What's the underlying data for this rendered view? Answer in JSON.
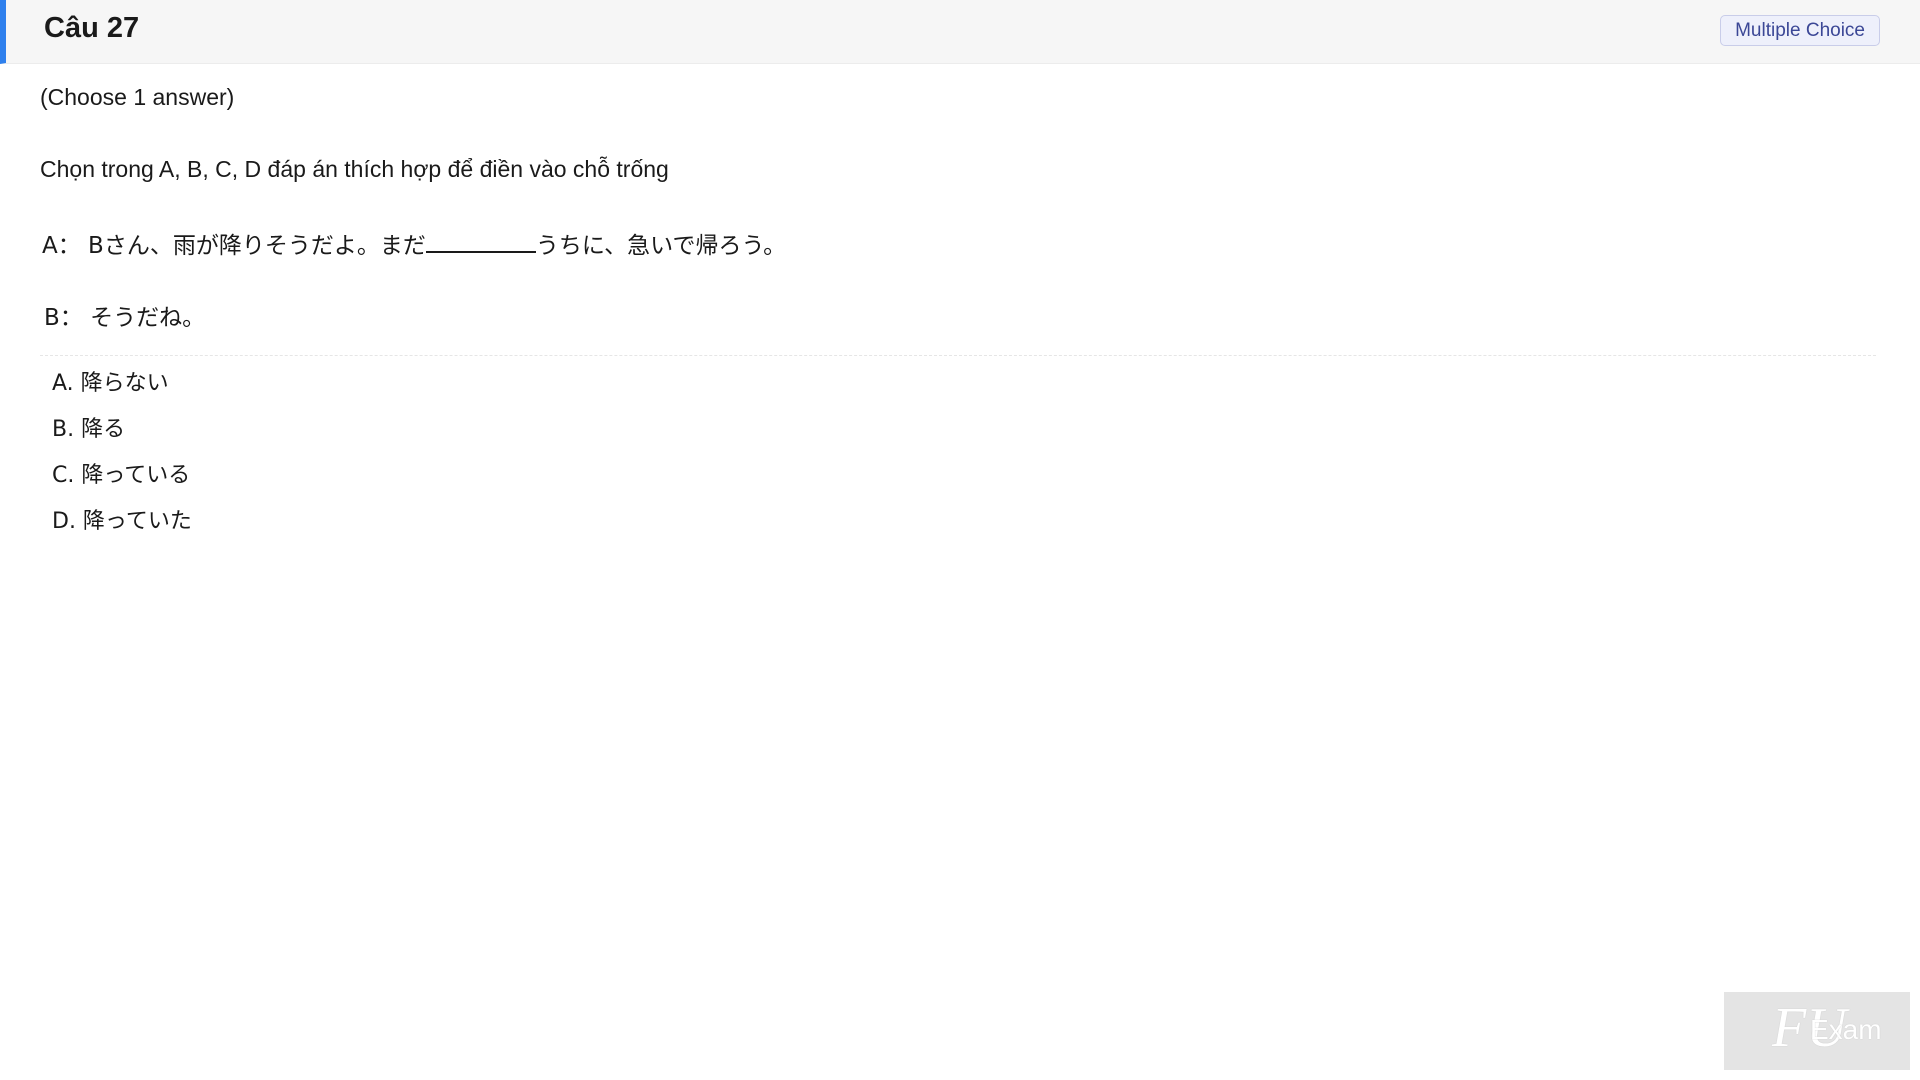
{
  "header": {
    "question_title": "Câu 27",
    "type_badge": "Multiple Choice"
  },
  "question": {
    "instruction": "(Choose 1 answer)",
    "prompt": "Chọn trong A, B, C, D đáp án thích hợp để điền vào chỗ trống",
    "line_a_before": "A： Bさん、雨が降りそうだよ。まだ",
    "line_a_after": "うちに、急いで帰ろう。",
    "line_b": "B： そうだね。"
  },
  "options": [
    {
      "label": "A. 降らない"
    },
    {
      "label": "B. 降る"
    },
    {
      "label": "C. 降っている"
    },
    {
      "label": "D. 降っていた"
    }
  ],
  "watermark": {
    "logo_text": "FU",
    "exam_text": "Exam"
  },
  "colors": {
    "accent": "#2f80ed",
    "badge_text": "#3b4796"
  }
}
